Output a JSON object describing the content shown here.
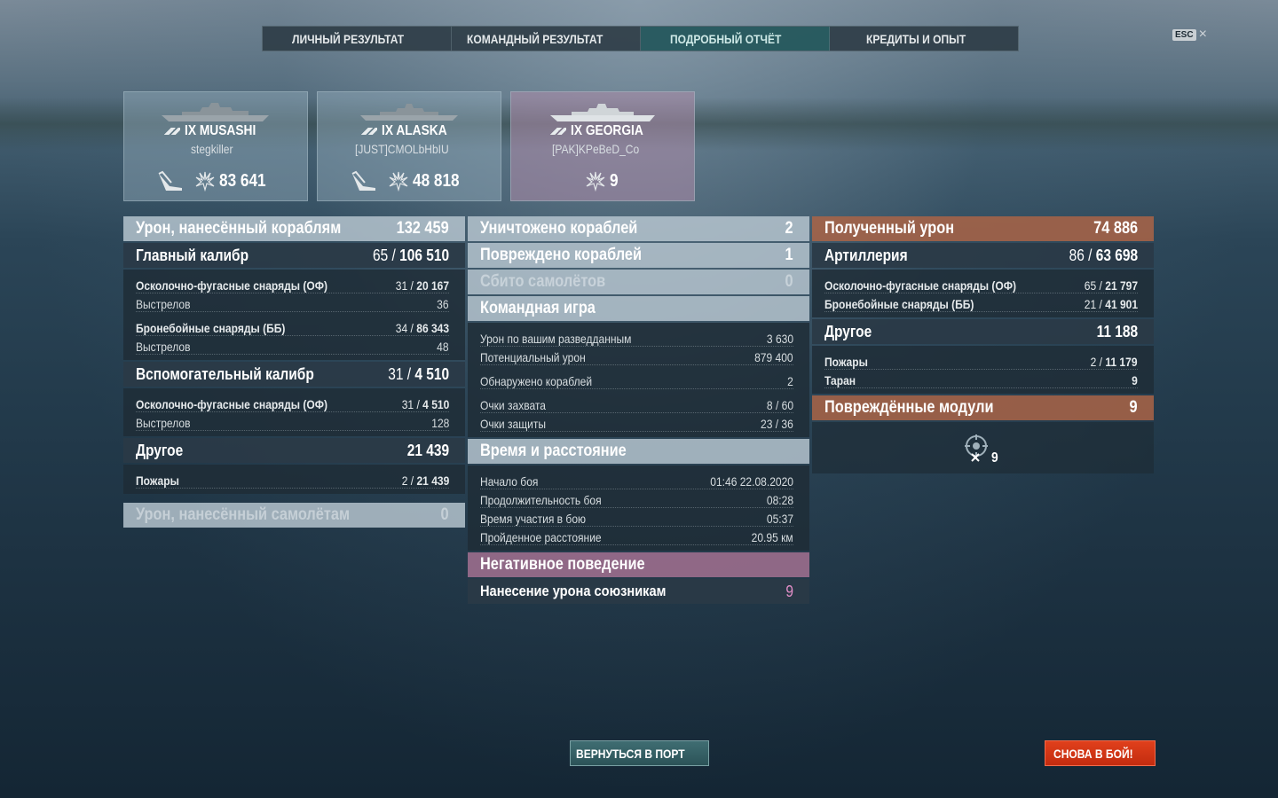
{
  "tabs": [
    {
      "label": "ЛИЧНЫЙ РЕЗУЛЬТАТ"
    },
    {
      "label": "КОМАНДНЫЙ РЕЗУЛЬТАТ"
    },
    {
      "label": "ПОДРОБНЫЙ ОТЧЁТ",
      "active": true
    },
    {
      "label": "КРЕДИТЫ И ОПЫТ"
    }
  ],
  "esc_label": "ESC",
  "ships": [
    {
      "tier_name": "IX MUSASHI",
      "player": "stegkiller",
      "damage": "83 641"
    },
    {
      "tier_name": "IX ALASKA",
      "player": "[JUST]CMOLbHbIU",
      "damage": "48 818"
    },
    {
      "tier_name": "IX GEORGIA",
      "player": "[PAK]KPeBeD_Co",
      "damage": "9"
    }
  ],
  "col1": {
    "header": {
      "label": "Урон, нанесённый кораблям",
      "value": "132 459"
    },
    "main_caliber": {
      "label": "Главный калибр",
      "value_a": "65",
      "value_b": "106 510"
    },
    "mc_he": {
      "label": "Осколочно-фугасные снаряды (ОФ)",
      "value_a": "31",
      "value_b": "20 167"
    },
    "mc_he_shots": {
      "label": "Выстрелов",
      "value": "36"
    },
    "mc_ap": {
      "label": "Бронебойные снаряды (ББ)",
      "value_a": "34",
      "value_b": "86 343"
    },
    "mc_ap_shots": {
      "label": "Выстрелов",
      "value": "48"
    },
    "secondary": {
      "label": "Вспомогательный калибр",
      "value_a": "31",
      "value_b": "4 510"
    },
    "sec_he": {
      "label": "Осколочно-фугасные снаряды (ОФ)",
      "value_a": "31",
      "value_b": "4 510"
    },
    "sec_he_shots": {
      "label": "Выстрелов",
      "value": "128"
    },
    "other": {
      "label": "Другое",
      "value": "21 439"
    },
    "fires": {
      "label": "Пожары",
      "value_a": "2",
      "value_b": "21 439"
    },
    "aircraft_dmg": {
      "label": "Урон, нанесённый самолётам",
      "value": "0"
    }
  },
  "col2": {
    "destroyed": {
      "label": "Уничтожено кораблей",
      "value": "2"
    },
    "damaged": {
      "label": "Повреждено кораблей",
      "value": "1"
    },
    "planes": {
      "label": "Сбито самолётов",
      "value": "0"
    },
    "team_play": {
      "label": "Командная игра"
    },
    "spot_dmg": {
      "label": "Урон по вашим разведданным",
      "value": "3 630"
    },
    "potential": {
      "label": "Потенциальный урон",
      "value": "879 400"
    },
    "detected": {
      "label": "Обнаружено кораблей",
      "value": "2"
    },
    "capture": {
      "label": "Очки захвата",
      "value": "8 / 60"
    },
    "defense": {
      "label": "Очки защиты",
      "value": "23 / 36"
    },
    "time": {
      "label": "Время и расстояние"
    },
    "start": {
      "label": "Начало боя",
      "value": "01:46  22.08.2020"
    },
    "duration": {
      "label": "Продолжительность боя",
      "value": "08:28"
    },
    "participation": {
      "label": "Время участия в бою",
      "value": "05:37"
    },
    "distance": {
      "label": "Пройденное расстояние",
      "value": "20.95 км"
    },
    "negative": {
      "label": "Негативное поведение"
    },
    "team_dmg": {
      "label": "Нанесение урона союзникам",
      "value": "9"
    }
  },
  "col3": {
    "received": {
      "label": "Полученный урон",
      "value": "74 886"
    },
    "artillery": {
      "label": "Артиллерия",
      "value_a": "86",
      "value_b": "63 698"
    },
    "art_he": {
      "label": "Осколочно-фугасные снаряды (ОФ)",
      "value_a": "65",
      "value_b": "21 797"
    },
    "art_ap": {
      "label": "Бронебойные снаряды (ББ)",
      "value_a": "21",
      "value_b": "41 901"
    },
    "other": {
      "label": "Другое",
      "value": "11 188"
    },
    "fires": {
      "label": "Пожары",
      "value_a": "2",
      "value_b": "11 179"
    },
    "ram": {
      "label": "Таран",
      "value": "9"
    },
    "modules": {
      "label": "Повреждённые модули",
      "value": "9"
    },
    "module_count": "9"
  },
  "buttons": {
    "port": "ВЕРНУТЬСЯ В ПОРТ",
    "battle": "СНОВА В БОЙ!"
  }
}
